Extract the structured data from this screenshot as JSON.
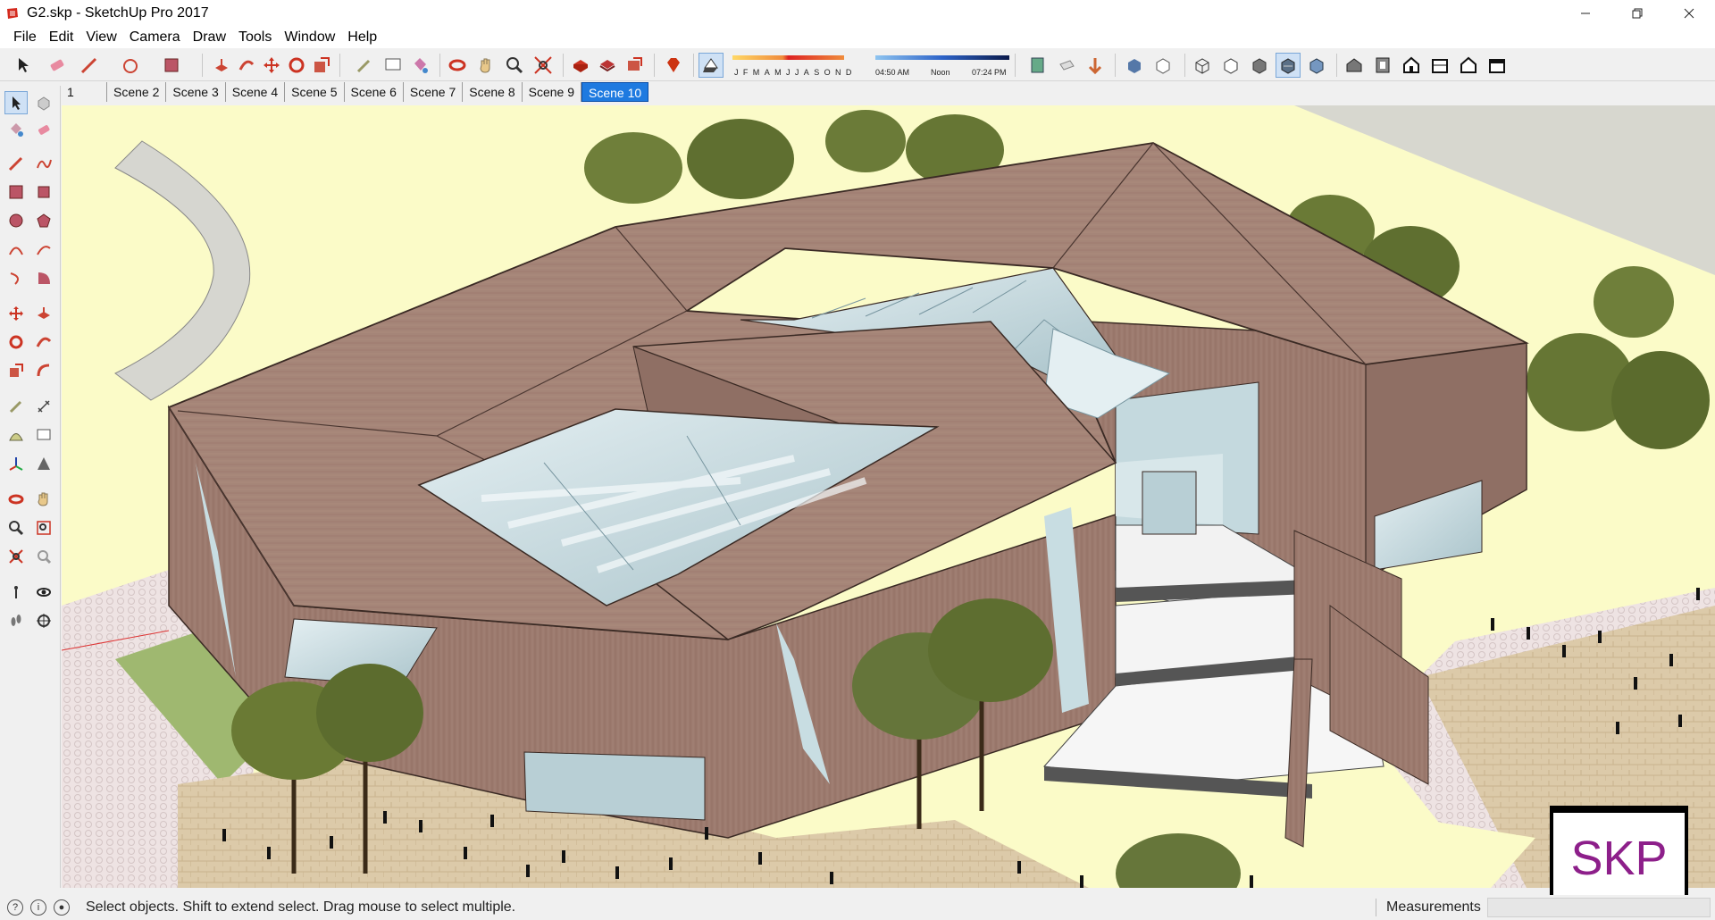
{
  "window": {
    "title": "G2.skp - SketchUp Pro 2017",
    "minimize_icon": "minimize-icon",
    "restore_icon": "restore-icon",
    "close_icon": "close-icon"
  },
  "menu": {
    "items": [
      "File",
      "Edit",
      "View",
      "Camera",
      "Draw",
      "Tools",
      "Window",
      "Help"
    ]
  },
  "shadow_panel": {
    "months": "JFMAMJJASOND",
    "time_start": "04:50 AM",
    "time_noon": "Noon",
    "time_end": "07:24 PM"
  },
  "scenes": {
    "tabs": [
      "1",
      "Scene 2",
      "Scene 3",
      "Scene 4",
      "Scene 5",
      "Scene 6",
      "Scene 7",
      "Scene 8",
      "Scene 9",
      "Scene 10"
    ],
    "active_index": 9
  },
  "status": {
    "message": "Select objects. Shift to extend select. Drag mouse to select multiple.",
    "measurements_label": "Measurements",
    "measurements_value": ""
  },
  "logo": {
    "text": "SKP"
  },
  "colors": {
    "roof": "#a07f73",
    "wall": "#9b7a6f",
    "glass": "#c9dde2",
    "ground": "#fbfbc8",
    "paving": "#d9c6a8",
    "active_tab": "#1e7ae0"
  }
}
